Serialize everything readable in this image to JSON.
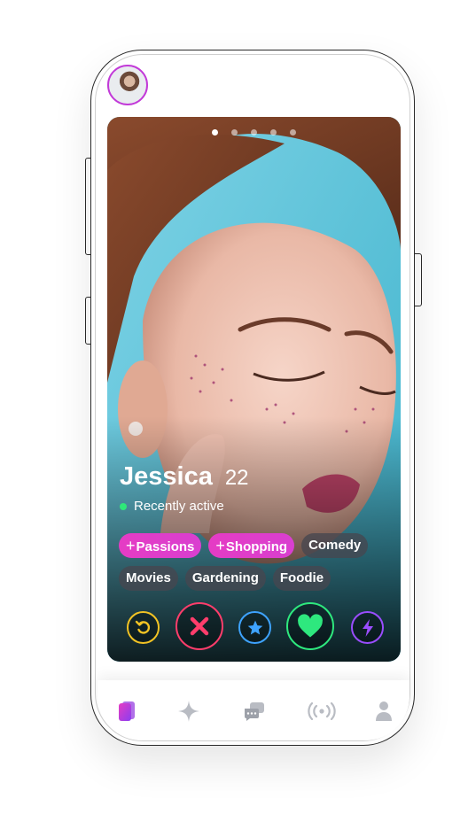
{
  "profile": {
    "name": "Jessica",
    "age": "22",
    "status": "Recently active",
    "photo_count": 5,
    "active_photo_index": 0
  },
  "tags": [
    {
      "label": "Passions",
      "highlighted": true
    },
    {
      "label": "Shopping",
      "highlighted": true
    },
    {
      "label": "Comedy",
      "highlighted": false
    },
    {
      "label": "Movies",
      "highlighted": false
    },
    {
      "label": "Gardening",
      "highlighted": false
    },
    {
      "label": "Foodie",
      "highlighted": false
    }
  ],
  "tag_plus_symbol": "+",
  "actions": [
    {
      "icon": "undo-icon",
      "color": "#f3c324"
    },
    {
      "icon": "close-icon",
      "color": "#ff3d6b"
    },
    {
      "icon": "star-icon",
      "color": "#3ea3ff"
    },
    {
      "icon": "heart-icon",
      "color": "#2ee87e"
    },
    {
      "icon": "bolt-icon",
      "color": "#9a4dff"
    }
  ],
  "tabbar": {
    "items": [
      {
        "icon": "cards-icon",
        "active": true
      },
      {
        "icon": "sparkle-icon",
        "active": false
      },
      {
        "icon": "chat-icon",
        "active": false
      },
      {
        "icon": "live-icon",
        "active": false
      },
      {
        "icon": "profile-icon",
        "active": false
      }
    ],
    "active_color": "#c23ad8",
    "inactive_color": "#b9bcc3"
  },
  "colors": {
    "accent": "#e53cc4",
    "status_online": "#2ee879"
  }
}
